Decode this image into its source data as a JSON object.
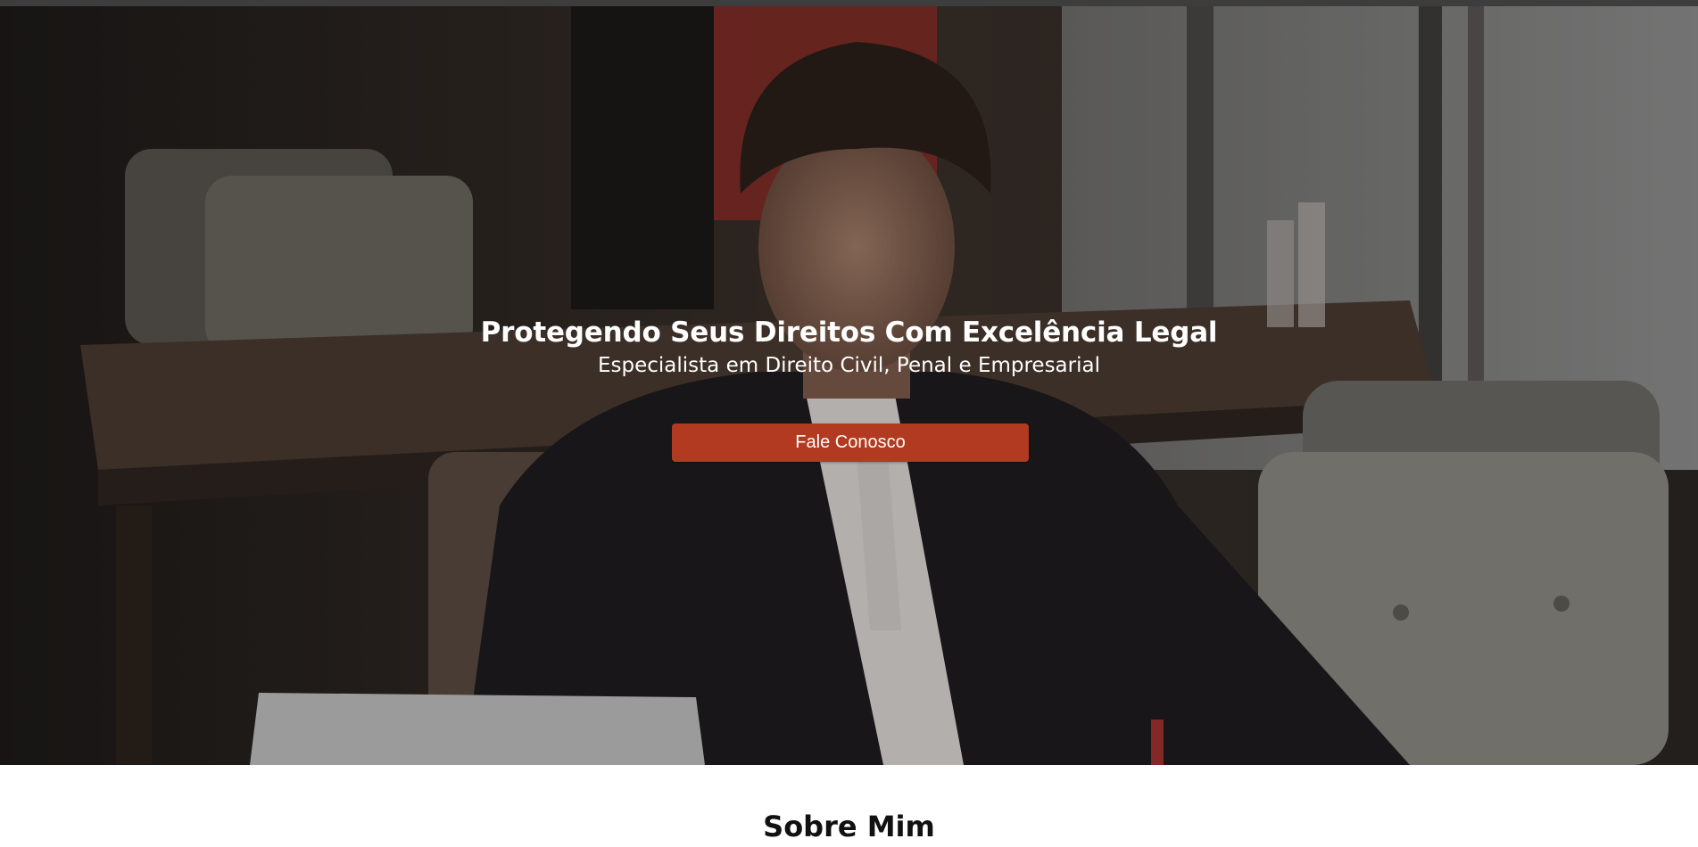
{
  "hero": {
    "title": "Protegendo Seus Direitos Com Excelência Legal",
    "subtitle": "Especialista em Direito Civil, Penal e Empresarial",
    "cta_label": "Fale Conosco",
    "background_image": "lawyer-working-at-cafe-photo"
  },
  "about": {
    "title": "Sobre Mim"
  },
  "colors": {
    "accent": "#b13a20",
    "topbar": "#3d3d3d",
    "heading_text": "#111111",
    "hero_text": "#ffffff"
  }
}
